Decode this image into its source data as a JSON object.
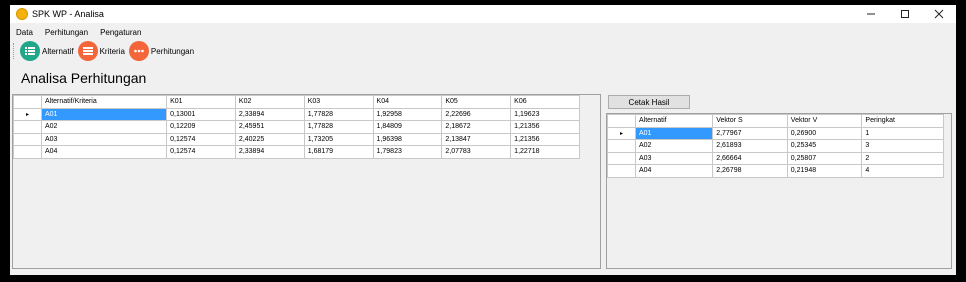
{
  "window": {
    "title": "SPK WP - Analisa",
    "minimize_icon": "minimize-icon",
    "maximize_icon": "maximize-icon",
    "close_icon": "close-icon"
  },
  "menu": [
    "Data",
    "Perhitungan",
    "Pengaturan"
  ],
  "toolbar": {
    "alternatif": "Alternatif",
    "kriteria": "Kriteria",
    "perhitungan": "Perhitungan",
    "colors": {
      "alternatif": "#1fa78a",
      "kriteria": "#f4663a",
      "perhitungan": "#f4663a"
    }
  },
  "heading": "Analisa Perhitungan",
  "left_table": {
    "headers": [
      "Alternatif/Kriteria",
      "K01",
      "K02",
      "K03",
      "K04",
      "K05",
      "K06"
    ],
    "rows": [
      [
        "A01",
        "0,13001",
        "2,33894",
        "1,77828",
        "1,92958",
        "2,22696",
        "1,19623"
      ],
      [
        "A02",
        "0,12209",
        "2,45951",
        "1,77828",
        "1,84809",
        "2,18672",
        "1,21356"
      ],
      [
        "A03",
        "0,12574",
        "2,40225",
        "1,73205",
        "1,96398",
        "2,13847",
        "1,21356"
      ],
      [
        "A04",
        "0,12574",
        "2,33894",
        "1,68179",
        "1,79823",
        "2,07783",
        "1,22718"
      ]
    ]
  },
  "cetak_button": "Cetak Hasil",
  "right_table": {
    "headers": [
      "Alternatif",
      "Vektor S",
      "Vektor V",
      "Peringkat"
    ],
    "rows": [
      [
        "A01",
        "2,77967",
        "0,26900",
        "1"
      ],
      [
        "A02",
        "2,61893",
        "0,25345",
        "3"
      ],
      [
        "A03",
        "2,66664",
        "0,25807",
        "2"
      ],
      [
        "A04",
        "2,26798",
        "0,21948",
        "4"
      ]
    ]
  },
  "row_pointer": "▸"
}
